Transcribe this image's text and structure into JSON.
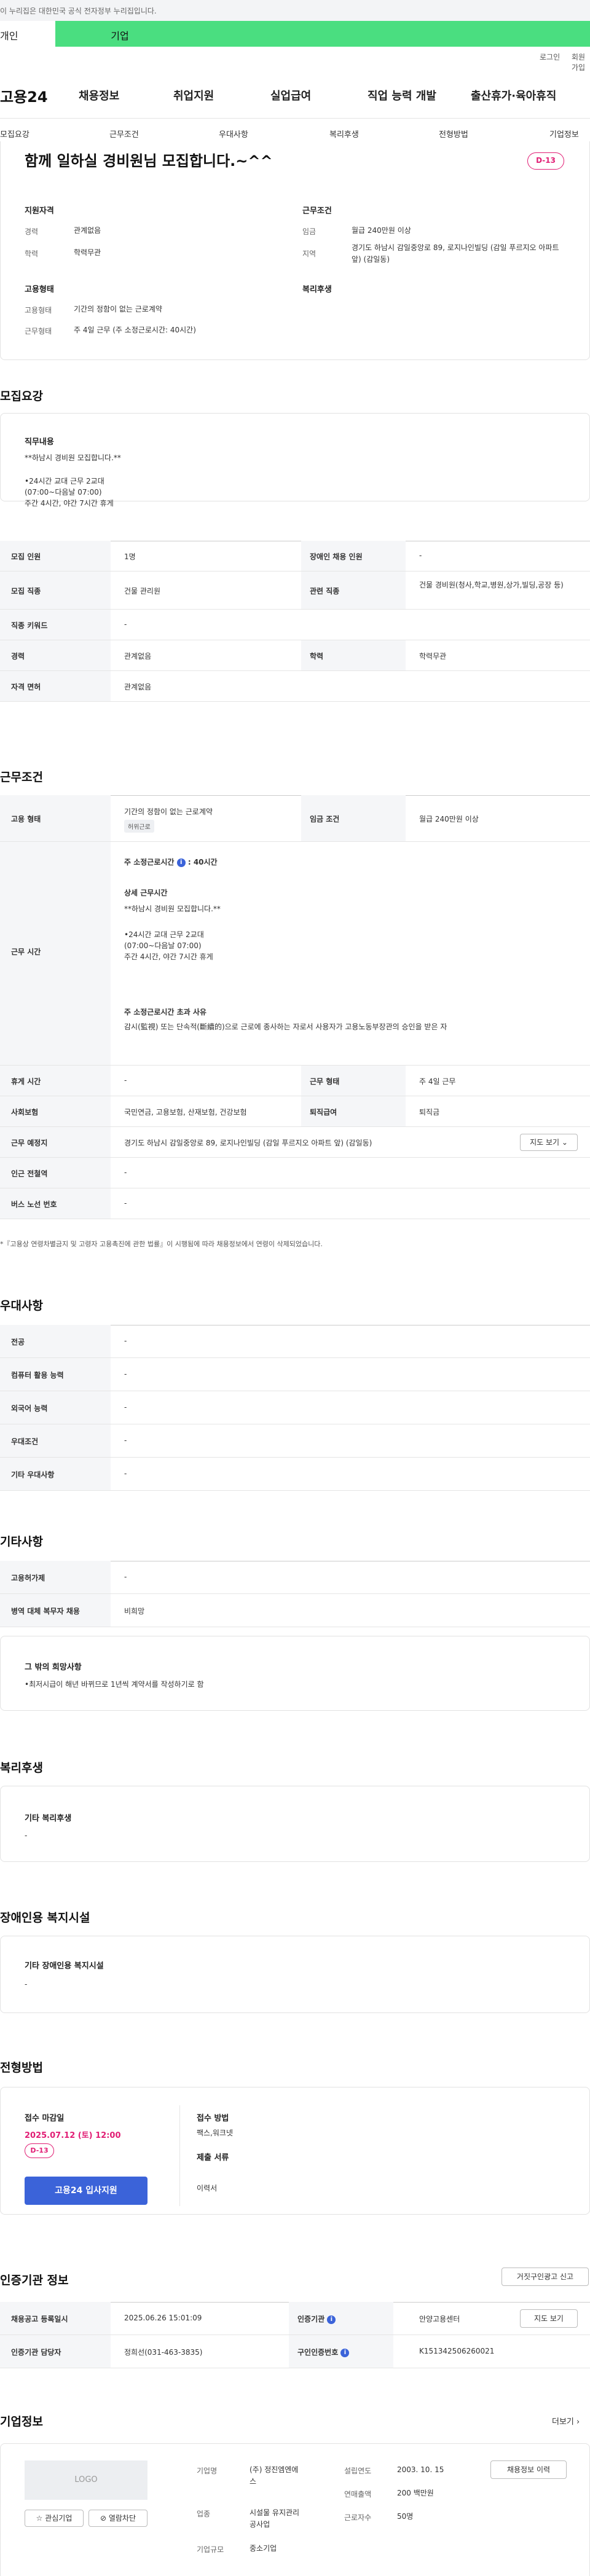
{
  "notice": "이 누리집은 대한민국 공식 전자정부 누리집입니다.",
  "top_tabs": {
    "personal": "개인",
    "company": "기업"
  },
  "utility": {
    "login": "로그인",
    "join": "회원가입"
  },
  "logo": "고용24",
  "gnb": [
    "채용정보",
    "취업지원",
    "실업급여",
    "직업 능력 개발",
    "출산휴가·육아휴직"
  ],
  "subnav": [
    "모집요강",
    "근무조건",
    "우대사항",
    "복리후생",
    "전형방법",
    "기업정보"
  ],
  "summary": {
    "title": "함께 일하실 경비원님 모집합니다.~^^",
    "dday": "D-13",
    "qualification": {
      "heading": "지원자격",
      "career_label": "경력",
      "career": "관계없음",
      "edu_label": "학력",
      "edu": "학력무관"
    },
    "conditions": {
      "heading": "근무조건",
      "wage_label": "임금",
      "wage": "월급 240만원 이상",
      "region_label": "지역",
      "region": "경기도 하남시 감일중앙로 89, 로지나인빌딩 (감일 푸르지오 아파트 앞) (감일동)"
    },
    "employment": {
      "heading": "고용형태",
      "type_label": "고용형태",
      "type": "기간의 정함이 없는 근로계약",
      "form_label": "근무형태",
      "form": "주 4일 근무 (주 소정근로시간: 40시간)"
    },
    "welfare": {
      "heading": "복리후생"
    }
  },
  "recruit": {
    "heading": "모집요강",
    "duty_heading": "직무내용",
    "duty_lines": [
      "**하남시 경비원 모집합니다.**",
      "",
      "•24시간 교대 근무 2교대",
      " (07:00~다음날 07:00)",
      "  주간 4시간, 야간 7시간 휴게"
    ],
    "rows": [
      {
        "l1": "모집 인원",
        "v1": "1명",
        "l2": "장애인 채용 인원",
        "v2": "-"
      },
      {
        "l1": "모집 직종",
        "v1": "건물 관리원",
        "l2": "관련 직종",
        "v2": "건물 경비원(청사,학교,병원,상가,빌딩,공장 등)"
      },
      {
        "l1": "직종 키워드",
        "v1": "-"
      },
      {
        "l1": "경력",
        "v1": "관계없음",
        "l2": "학력",
        "v2": "학력무관"
      },
      {
        "l1": "자격 면허",
        "v1": "관계없음"
      }
    ]
  },
  "work": {
    "heading": "근무조건",
    "emp_type_label": "고용 형태",
    "emp_type": "기간의 정함이 없는 근로계약",
    "emp_type_tag": "허위근로",
    "wage_label": "임금 조건",
    "wage": "월급 240만원 이상",
    "hours_label": "근무 시간",
    "hours_title": "주 소정근로시간",
    "hours_value": "40시간",
    "detail_title": "상세 근무시간",
    "detail_lines": [
      "**하남시 경비원 모집합니다.**",
      "",
      "•24시간 교대 근무 2교대",
      " (07:00~다음날 07:00)",
      "  주간 4시간, 야간 7시간 휴게"
    ],
    "over_title": "주 소정근로시간 초과 사유",
    "over_text": "감시(監視) 또는 단속적(斷續的)으로 근로에 종사하는 자로서 사용자가 고용노동부장관의 승인을 받은 자",
    "rows": [
      {
        "l1": "휴게 시간",
        "v1": "-",
        "l2": "근무 형태",
        "v2": "주 4일 근무"
      },
      {
        "l1": "사회보험",
        "v1": "국민연금, 고용보험, 산재보험, 건강보험",
        "l2": "퇴직급여",
        "v2": "퇴직금"
      }
    ],
    "place_label": "근무 예정지",
    "place": "경기도 하남시 감일중앙로 89, 로지나인빌딩 (감일 푸르지오 아파트 앞) (감일동)",
    "map_btn": "지도 보기 ⌄",
    "station_label": "인근 전철역",
    "station": "-",
    "bus_label": "버스 노선 번호",
    "bus": "-",
    "notice": "*『고용상 연령차별금지 및 고령자 고용촉진에 관한 법률』이 시행됨에 따라 채용정보에서 연령이 삭제되었습니다."
  },
  "preference": {
    "heading": "우대사항",
    "rows": [
      {
        "l": "전공",
        "v": "-"
      },
      {
        "l": "컴퓨터 활용 능력",
        "v": "-"
      },
      {
        "l": "외국어 능력",
        "v": "-"
      },
      {
        "l": "우대조건",
        "v": "-"
      },
      {
        "l": "기타 우대사항",
        "v": "-"
      }
    ]
  },
  "etc": {
    "heading": "기타사항",
    "rows": [
      {
        "l": "고용허가제",
        "v": "-"
      },
      {
        "l": "병역 대체 복무자 채용",
        "v": "비희망"
      }
    ],
    "other_title": "그 밖의 희망사항",
    "other_text": "•최저시급이 해년 바뀌므로 1년씩 계약서를 작성하기로 함"
  },
  "welfare": {
    "heading": "복리후생",
    "box_title": "기타 복리후생",
    "box_text": "-"
  },
  "disabled": {
    "heading": "장애인용 복지시설",
    "box_title": "기타 장애인용 복지시설",
    "box_text": "-"
  },
  "selection": {
    "heading": "전형방법",
    "deadline_label": "접수 마감일",
    "deadline": "2025.07.12 (토) 12:00",
    "dday": "D-13",
    "apply_btn": "고용24 입사지원",
    "method_label": "접수 방법",
    "method": "팩스,워크넷",
    "docs_label": "제출 서류",
    "docs": "이력서"
  },
  "agency": {
    "heading": "인증기관 정보",
    "report_btn": "거짓구인광고 신고",
    "reg_label": "채용공고 등록일시",
    "reg": "2025.06.26 15:01:09",
    "org_label": "인증기관",
    "org": "안양고용센터",
    "map_btn": "지도 보기",
    "staff_label": "인증기관 담당자",
    "staff": "정희선(031-463-3835)",
    "jobno_label": "구인인증번호",
    "jobno": "K151342506260021"
  },
  "company": {
    "heading": "기업정보",
    "more": "더보기 ›",
    "logo": "LOGO",
    "fav_btn": "☆ 관심기업",
    "hide_btn": "⊘ 열람차단",
    "name_label": "기업명",
    "name": "(주) 정진엠엔에스",
    "industry_label": "업종",
    "industry": "시설물 유지관리 공사업",
    "size_label": "기업규모",
    "size": "중소기업",
    "year_label": "설립연도",
    "year": "2003. 10. 15",
    "sales_label": "연매출액",
    "sales": "200 백만원",
    "staff_label": "근로자수",
    "staff": "50명",
    "jobs_btn": "채용정보 이력"
  }
}
